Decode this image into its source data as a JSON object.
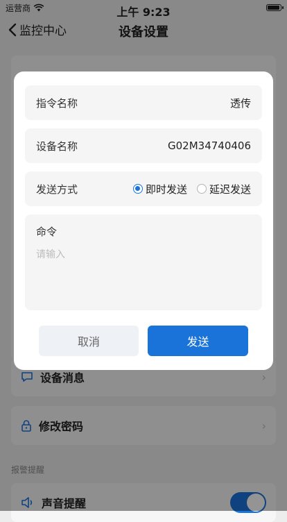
{
  "statusbar": {
    "carrier": "运营商",
    "time": "上午 9:23"
  },
  "nav": {
    "back_label": "监控中心",
    "title": "设备设置"
  },
  "background": {
    "device_messages": "设备消息",
    "change_password": "修改密码",
    "alarm_section": "报警提醒",
    "sound_alert": "声音提醒",
    "sound_alert_on": true
  },
  "dialog": {
    "command_name_label": "指令名称",
    "command_name_value": "透传",
    "device_name_label": "设备名称",
    "device_name_value": "G02M34740406",
    "send_mode_label": "发送方式",
    "send_mode_options": [
      "即时发送",
      "延迟发送"
    ],
    "send_mode_selected": "即时发送",
    "command_label": "命令",
    "command_placeholder": "请输入",
    "cancel_label": "取消",
    "send_label": "发送"
  },
  "colors": {
    "accent": "#1a73d9"
  }
}
